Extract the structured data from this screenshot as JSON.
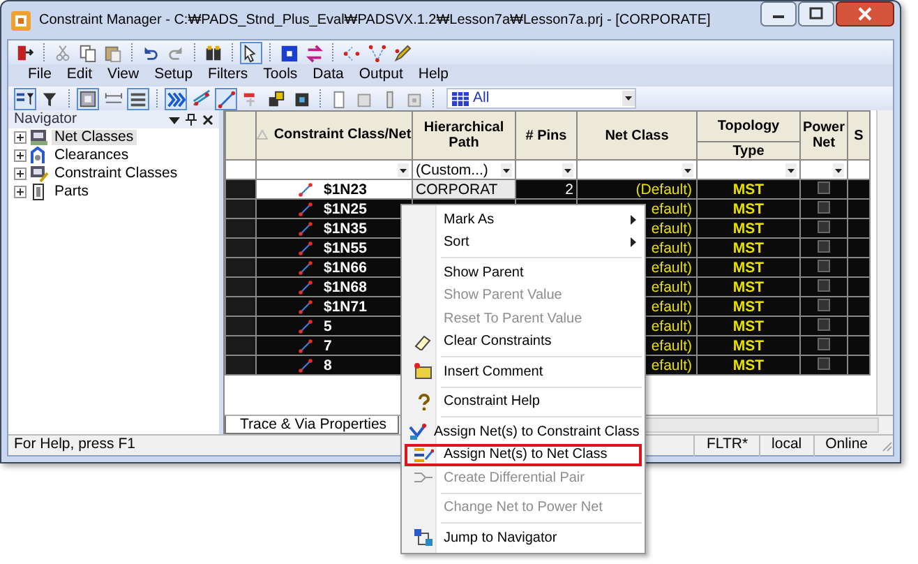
{
  "window": {
    "title": "Constraint Manager - C:₩PADS_Stnd_Plus_Eval₩PADSVX.1.2₩Lesson7a₩Lesson7a.prj - [CORPORATE]"
  },
  "toolbar_1": [
    {
      "kind": "button",
      "pressed": false
    },
    {
      "kind": "separator"
    },
    {
      "kind": "button",
      "pressed": false
    },
    {
      "kind": "button",
      "pressed": false
    },
    {
      "kind": "button",
      "pressed": false
    },
    {
      "kind": "separator"
    },
    {
      "kind": "button",
      "pressed": false
    },
    {
      "kind": "button",
      "pressed": false
    },
    {
      "kind": "separator"
    },
    {
      "kind": "button",
      "pressed": false
    },
    {
      "kind": "separator"
    },
    {
      "kind": "button",
      "pressed": true
    },
    {
      "kind": "separator"
    },
    {
      "kind": "button",
      "pressed": false
    },
    {
      "kind": "button",
      "pressed": false
    },
    {
      "kind": "separator"
    },
    {
      "kind": "button",
      "pressed": false
    },
    {
      "kind": "button",
      "pressed": false
    },
    {
      "kind": "button",
      "pressed": false
    }
  ],
  "menu_bar": [
    "File",
    "Edit",
    "View",
    "Setup",
    "Filters",
    "Tools",
    "Data",
    "Output",
    "Help"
  ],
  "toolbar_2": [
    {
      "kind": "button",
      "pressed": true
    },
    {
      "kind": "button",
      "pressed": false
    },
    {
      "kind": "separator"
    },
    {
      "kind": "button",
      "pressed": true
    },
    {
      "kind": "button",
      "pressed": false
    },
    {
      "kind": "button",
      "pressed": true
    },
    {
      "kind": "separator"
    },
    {
      "kind": "button",
      "pressed": true
    },
    {
      "kind": "button",
      "pressed": false
    },
    {
      "kind": "button",
      "pressed": true
    },
    {
      "kind": "button",
      "pressed": false
    },
    {
      "kind": "button",
      "pressed": false
    },
    {
      "kind": "button",
      "pressed": false
    },
    {
      "kind": "separator"
    },
    {
      "kind": "button",
      "pressed": false
    },
    {
      "kind": "button",
      "pressed": false
    },
    {
      "kind": "button",
      "pressed": false
    },
    {
      "kind": "button",
      "pressed": false
    },
    {
      "kind": "separator"
    }
  ],
  "scheme_filter": {
    "value": "All"
  },
  "navigator": {
    "title": "Navigator",
    "items": [
      {
        "label": "Net Classes",
        "selected": true,
        "expanded": false
      },
      {
        "label": "Clearances",
        "selected": false,
        "expanded": false
      },
      {
        "label": "Constraint Classes",
        "selected": false,
        "expanded": false
      },
      {
        "label": "Parts",
        "selected": false,
        "expanded": false
      }
    ]
  },
  "grid": {
    "columns": [
      {
        "label": "Constraint Class/Net",
        "sorted": true
      },
      {
        "label": "Hierarchical Path",
        "filter": "(Custom...)"
      },
      {
        "label": "# Pins"
      },
      {
        "label": "Net Class"
      },
      {
        "label": "Topology",
        "sub_label": "Type"
      },
      {
        "label": "Power Net"
      },
      {
        "label": "S"
      }
    ],
    "rows": [
      {
        "name": "$1N23",
        "path": "CORPORAT",
        "pins": "2",
        "net_class": "(Default)",
        "topology": "MST",
        "power_net": false,
        "selected": true,
        "current": true
      },
      {
        "name": "$1N25",
        "net_class": "efault)",
        "topology": "MST",
        "power_net": false,
        "selected": true,
        "current": false
      },
      {
        "name": "$1N35",
        "net_class": "efault)",
        "topology": "MST",
        "power_net": false,
        "selected": true,
        "current": false
      },
      {
        "name": "$1N55",
        "net_class": "efault)",
        "topology": "MST",
        "power_net": false,
        "selected": true,
        "current": false
      },
      {
        "name": "$1N66",
        "net_class": "efault)",
        "topology": "MST",
        "power_net": false,
        "selected": true,
        "current": false
      },
      {
        "name": "$1N68",
        "net_class": "efault)",
        "topology": "MST",
        "power_net": false,
        "selected": true,
        "current": false
      },
      {
        "name": "$1N71",
        "net_class": "efault)",
        "topology": "MST",
        "power_net": false,
        "selected": true,
        "current": false
      },
      {
        "name": "5",
        "net_class": "efault)",
        "topology": "MST",
        "power_net": false,
        "selected": true,
        "current": false
      },
      {
        "name": "7",
        "net_class": "efault)",
        "topology": "MST",
        "power_net": false,
        "selected": true,
        "current": false
      },
      {
        "name": "8",
        "net_class": "efault)",
        "topology": "MST",
        "power_net": false,
        "selected": true,
        "current": false
      }
    ]
  },
  "tabs": [
    {
      "label": "Trace & Via Properties",
      "selected": true
    }
  ],
  "status_bar": {
    "message": "For Help, press F1",
    "panes": [
      "FLTR*",
      "local",
      "Online"
    ]
  },
  "context_menu": {
    "items": [
      {
        "kind": "item",
        "label": "Mark As",
        "submenu": true,
        "disabled": false,
        "highlighted": false
      },
      {
        "kind": "item",
        "label": "Sort",
        "submenu": true,
        "disabled": false,
        "highlighted": false
      },
      {
        "kind": "separator"
      },
      {
        "kind": "item",
        "label": "Show Parent",
        "submenu": false,
        "disabled": false,
        "highlighted": false
      },
      {
        "kind": "item",
        "label": "Show Parent Value",
        "submenu": false,
        "disabled": true,
        "highlighted": false
      },
      {
        "kind": "item",
        "label": "Reset To Parent Value",
        "submenu": false,
        "disabled": true,
        "highlighted": false
      },
      {
        "kind": "item",
        "label": "Clear Constraints",
        "submenu": false,
        "disabled": false,
        "highlighted": false
      },
      {
        "kind": "separator"
      },
      {
        "kind": "item",
        "label": "Insert Comment",
        "submenu": false,
        "disabled": false,
        "highlighted": false
      },
      {
        "kind": "separator"
      },
      {
        "kind": "item",
        "label": "Constraint Help",
        "submenu": false,
        "disabled": false,
        "highlighted": false
      },
      {
        "kind": "separator"
      },
      {
        "kind": "item",
        "label": "Assign Net(s) to Constraint Class",
        "submenu": false,
        "disabled": false,
        "highlighted": false
      },
      {
        "kind": "item",
        "label": "Assign Net(s) to Net Class",
        "submenu": false,
        "disabled": false,
        "highlighted": true
      },
      {
        "kind": "item",
        "label": "Create Differential Pair",
        "submenu": false,
        "disabled": true,
        "highlighted": false
      },
      {
        "kind": "separator"
      },
      {
        "kind": "item",
        "label": "Change Net to Power Net",
        "submenu": false,
        "disabled": true,
        "highlighted": false
      },
      {
        "kind": "separator"
      },
      {
        "kind": "item",
        "label": "Jump to Navigator",
        "submenu": false,
        "disabled": false,
        "highlighted": false
      }
    ]
  }
}
